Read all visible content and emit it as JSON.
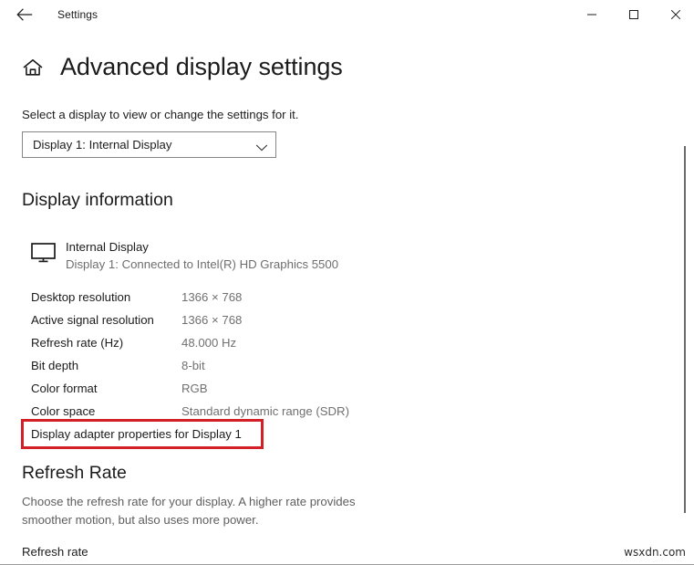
{
  "window": {
    "app_title": "Settings",
    "back_icon": "back-arrow-icon",
    "minimize_label": "—",
    "maximize_label": "❐",
    "close_label": "✕"
  },
  "header": {
    "home_icon": "home-icon",
    "page_title": "Advanced display settings"
  },
  "select_display": {
    "description": "Select a display to view or change the settings for it.",
    "selected_value": "Display 1: Internal Display",
    "chevron_icon": "chevron-down-icon"
  },
  "display_information": {
    "heading": "Display information",
    "monitor_icon": "monitor-icon",
    "monitor_name": "Internal Display",
    "monitor_subtitle": "Display 1: Connected to Intel(R) HD Graphics 5500",
    "rows": [
      {
        "label": "Desktop resolution",
        "value": "1366 × 768"
      },
      {
        "label": "Active signal resolution",
        "value": "1366 × 768"
      },
      {
        "label": "Refresh rate (Hz)",
        "value": "48.000 Hz"
      },
      {
        "label": "Bit depth",
        "value": "8-bit"
      },
      {
        "label": "Color format",
        "value": "RGB"
      },
      {
        "label": "Color space",
        "value": "Standard dynamic range (SDR)"
      }
    ],
    "adapter_link": "Display adapter properties for Display 1",
    "highlight_color": "#d31f26"
  },
  "refresh_rate": {
    "heading": "Refresh Rate",
    "description": "Choose the refresh rate for your display. A higher rate provides smoother motion, but also uses more power.",
    "field_label": "Refresh rate"
  },
  "footer": {
    "watermark": "wsxdn.com"
  }
}
